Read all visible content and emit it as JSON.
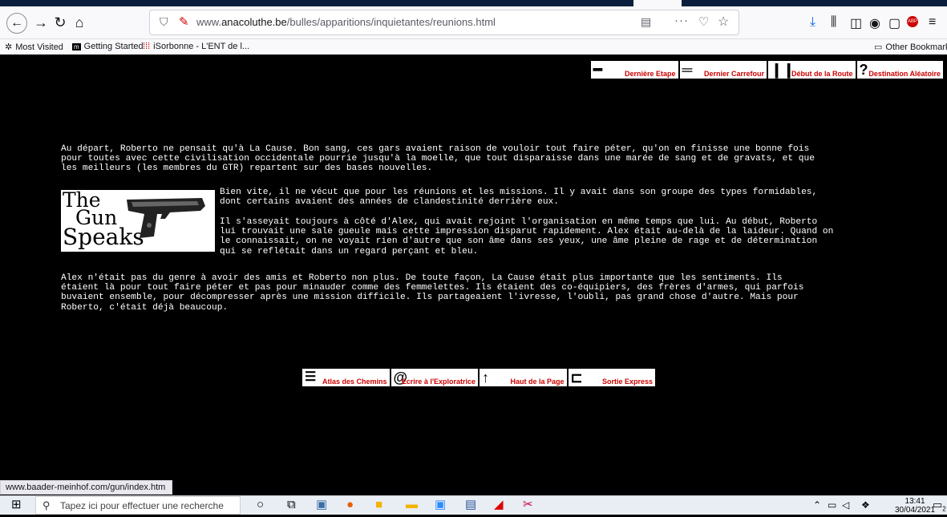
{
  "browser": {
    "url_prefix": "www.",
    "url_domain": "anacoluthe.be",
    "url_path": "/bulles/apparitions/inquietantes/reunions.html",
    "bookmarks": [
      "Most Visited",
      "Getting Started",
      "iSorbonne - L'ENT de l...",
      "Other Bookmarks"
    ],
    "status_url": "www.baader-meinhof.com/gun/index.htm"
  },
  "page": {
    "top_nav": [
      "Dernière Etape",
      "Dernier Carrefour",
      "Début de la Route",
      "Destination Aléatoire"
    ],
    "para1": "Au départ, Roberto ne pensait qu'à La Cause. Bon sang, ces gars avaient raison de vouloir tout faire péter, qu'on en finisse une bonne fois\npour toutes avec cette civilisation occidentale pourrie jusqu'à la moelle, que tout disparaisse dans une marée de sang et de gravats, et que\nles meilleurs (les membres du GTR) repartent sur des bases nouvelles.",
    "para2": "Bien vite, il ne vécut que pour les réunions et les missions. Il y avait dans son groupe des types formidables,\ndont certains avaient des années de clandestinité derrière eux.",
    "para3": "Il s'asseyait toujours à côté d'Alex, qui avait rejoint l'organisation en même temps que lui. Au début, Roberto\nlui trouvait une sale gueule mais cette impression disparut rapidement. Alex était au-delà de la laideur. Quand on\nle connaissait, on ne voyait rien d'autre que son âme dans ses yeux, une âme pleine de rage et de détermination\nqui se reflétait dans un regard perçant et bleu.",
    "para4": "Alex n'était pas du genre à avoir des amis et Roberto non plus. De toute façon, La Cause était plus importante que les sentiments. Ils\nétaient là pour tout faire péter et pas pour minauder comme des femmelettes. Ils étaient des co-équipiers, des frères d'armes, qui parfois\nbuvaient ensemble, pour décompresser après une mission difficile. Ils partageaient l'ivresse, l'oubli, pas grand chose d'autre. Mais pour\nRoberto, c'était déjà beaucoup.",
    "logo_words": [
      "The",
      "Gun",
      "Speaks"
    ],
    "bottom_nav": [
      "Atlas des Chemins",
      "Ecrire à l'Exploratrice",
      "Haut de la Page",
      "Sortie Express"
    ]
  },
  "taskbar": {
    "search_placeholder": "Tapez ici pour effectuer une recherche",
    "time": "13:41",
    "date": "30/04/2021",
    "notification_count": "2"
  }
}
